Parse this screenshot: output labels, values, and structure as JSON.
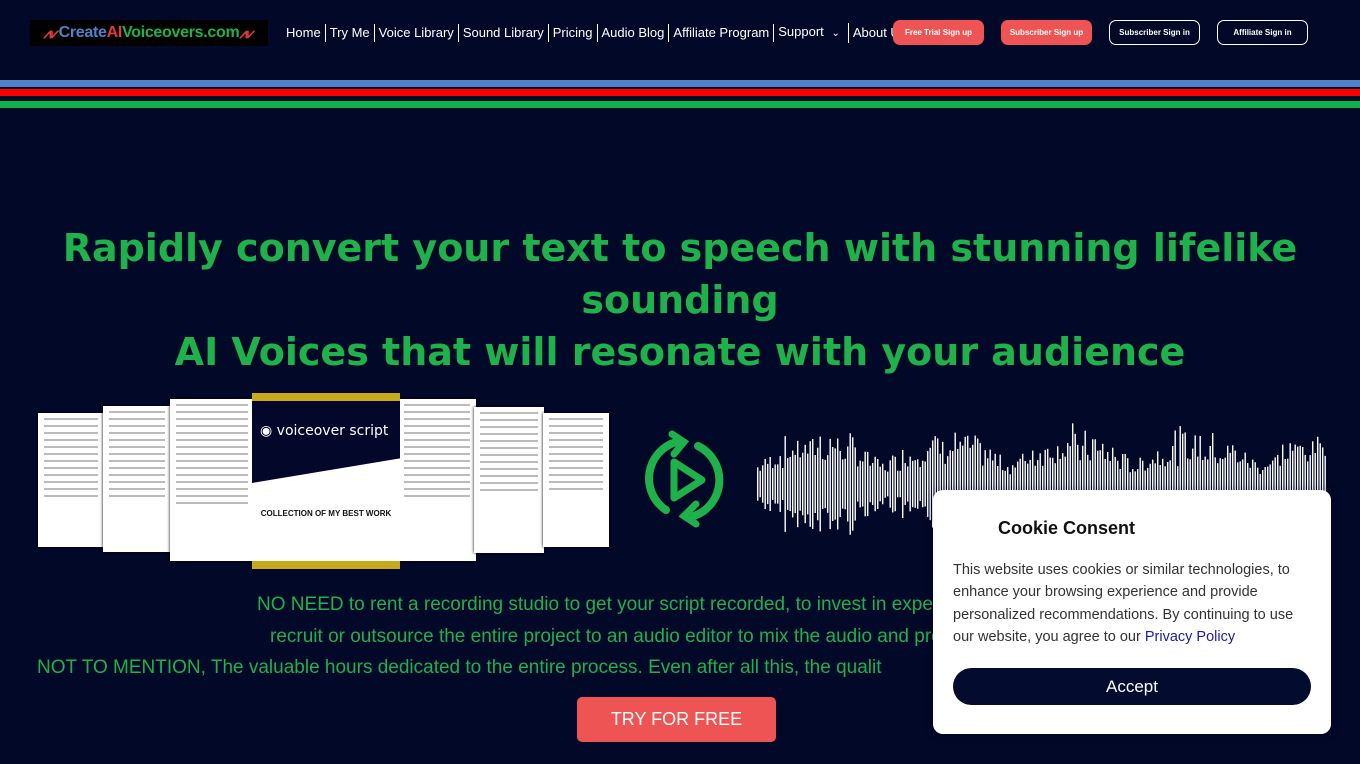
{
  "header": {
    "logo": {
      "part1": "Create",
      "part2": "AI",
      "part3": "Voiceovers.com"
    },
    "nav": [
      {
        "label": "Home"
      },
      {
        "label": "Try Me"
      },
      {
        "label": "Voice Library"
      },
      {
        "label": "Sound Library"
      },
      {
        "label": "Pricing"
      },
      {
        "label": "Audio Blog"
      },
      {
        "label": "Affiliate Program"
      },
      {
        "label": "Support"
      },
      {
        "label": "About Us"
      }
    ],
    "buttons": {
      "free_trial": "Free Trial Sign up",
      "subscriber_signup": "Subscriber Sign up",
      "subscriber_signin": "Subscriber Sign in",
      "affiliate_signin": "Affiliate Sign in"
    }
  },
  "colors": {
    "background": "#020828",
    "accent_green": "#1fb24a",
    "accent_red": "#ee5454",
    "stripe_blue": "#4f82c8",
    "stripe_red": "#ff0000",
    "stripe_green": "#0fb04a"
  },
  "hero": {
    "headline_line1": "Rapidly convert your text to speech with stunning lifelike sounding",
    "headline_line2": "AI Voices that will resonate with your audience",
    "cover_title": "voiceover script",
    "cover_subtitle": "COLLECTION OF MY BEST WORK",
    "para1_strong": "NO NEED",
    "para1": " to rent a recording studio to get your script recorded, to invest in expensive recording equi",
    "para2": "recruit or outsource the entire project to an audio editor to mix the audio and produ",
    "para3_strong": "NOT TO MENTION,",
    "para3": " The valuable hours dedicated to the entire process. Even after all this, the qualit",
    "cta": "TRY FOR FREE"
  },
  "cookie": {
    "title": "Cookie Consent",
    "text": "This website uses cookies or similar technologies, to enhance your browsing experience and provide personalized recommendations. By continuing to use our website, you agree to our ",
    "link": "Privacy Policy",
    "accept": "Accept"
  }
}
